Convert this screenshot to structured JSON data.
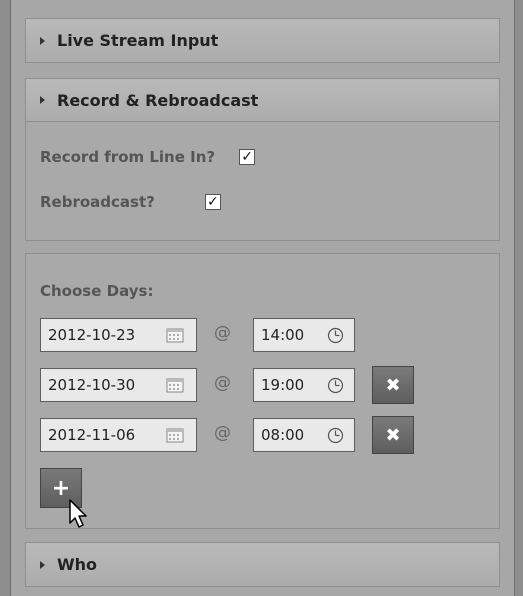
{
  "sections": {
    "live_stream_input": {
      "title": "Live Stream Input"
    },
    "record_rebroadcast": {
      "title": "Record & Rebroadcast",
      "record_label": "Record from Line In?",
      "record_checked": true,
      "rebroadcast_label": "Rebroadcast?",
      "rebroadcast_checked": true
    },
    "days": {
      "label": "Choose Days:",
      "at_symbol": "@",
      "rows": [
        {
          "date": "2012-10-23",
          "time": "14:00"
        },
        {
          "date": "2012-10-30",
          "time": "19:00"
        },
        {
          "date": "2012-11-06",
          "time": "08:00"
        }
      ]
    },
    "who": {
      "title": "Who"
    }
  },
  "icons": {
    "check": "✓",
    "remove": "✖",
    "add": "+"
  }
}
